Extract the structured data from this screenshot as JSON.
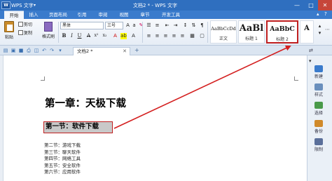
{
  "titlebar": {
    "app_logo_text": "W",
    "app_name": "WPS 文字",
    "app_caret": "▾",
    "window_title": "文档2 * - WPS 文字",
    "minimize": "—",
    "maximize": "□",
    "close": "✕"
  },
  "menu": {
    "items": [
      "开始",
      "插入",
      "页面布局",
      "引用",
      "审阅",
      "视图",
      "章节",
      "开发工具"
    ],
    "active": "开始",
    "right_icons": [
      "▴",
      "?"
    ]
  },
  "ribbon": {
    "paste_label": "粘贴",
    "cut_label": "剪切",
    "copy_label": "复制",
    "format_painter_label": "格式刷",
    "font_name": "黑体",
    "font_size": "三号",
    "format_buttons": [
      "B",
      "I",
      "U",
      "A",
      "x²",
      "x₂"
    ],
    "styles": [
      {
        "sample": "AaBbCcDd",
        "name": "正文"
      },
      {
        "sample": "AaBl",
        "name": "标题 1"
      },
      {
        "sample": "AaBbC",
        "name": "标题 2"
      }
    ],
    "more_label": "A"
  },
  "tabbar": {
    "doc_tab": "文档2 *",
    "tab_close": "✕",
    "new_tab": "+",
    "right_icon": "⇄"
  },
  "document": {
    "heading1": "第一章：天极下载",
    "heading2": "第一节：软件下载",
    "list": [
      "第二节：游戏下载",
      "第三节：聊天软件",
      "第四节：网络工具",
      "第五节：安全软件",
      "第六节：应用软件"
    ]
  },
  "taskpane": {
    "top_icon": "▾",
    "items": [
      {
        "label": "新建",
        "color": "#3a7bcc"
      },
      {
        "label": "样式",
        "color": "#6a8fbd"
      },
      {
        "label": "选择",
        "color": "#4a9a4a"
      },
      {
        "label": "备份",
        "color": "#d08a2a"
      },
      {
        "label": "限制",
        "color": "#5a6f9a"
      }
    ]
  },
  "colors": {
    "titlebar": "#2f6fbf",
    "menubar": "#3a7bcc",
    "annotation_red": "#d42020",
    "highlight_border": "#c02020"
  }
}
